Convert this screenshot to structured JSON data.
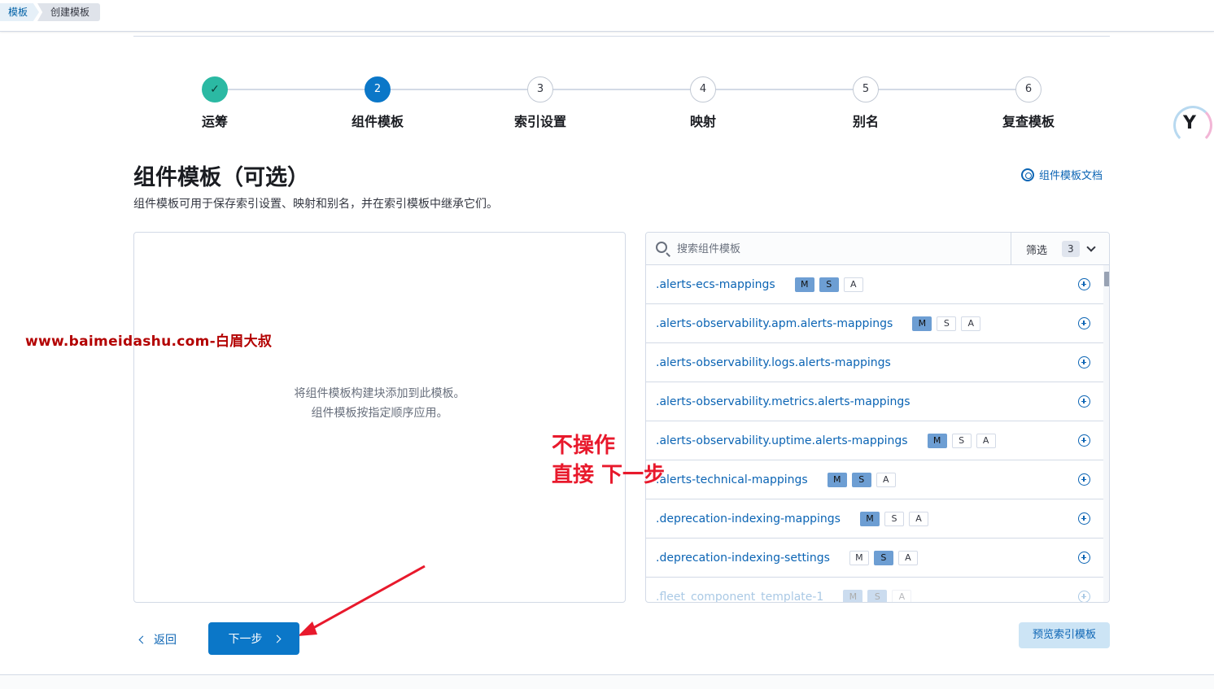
{
  "breadcrumbs": [
    "模板",
    "创建模板"
  ],
  "steps": [
    {
      "num": "✓",
      "label": "运筹",
      "state": "done"
    },
    {
      "num": "2",
      "label": "组件模板",
      "state": "active"
    },
    {
      "num": "3",
      "label": "索引设置",
      "state": "todo"
    },
    {
      "num": "4",
      "label": "映射",
      "state": "todo"
    },
    {
      "num": "5",
      "label": "别名",
      "state": "todo"
    },
    {
      "num": "6",
      "label": "复查模板",
      "state": "todo"
    }
  ],
  "page": {
    "title": "组件模板（可选）",
    "subtitle": "组件模板可用于保存索引设置、映射和别名，并在索引模板中继承它们。",
    "doc_link": "组件模板文档",
    "doc_icon": "help-circle-icon"
  },
  "left_panel": {
    "empty_line1": "将组件模板构建块添加到此模板。",
    "empty_line2": "组件模板按指定顺序应用。"
  },
  "search": {
    "placeholder": "搜索组件模板",
    "filter_label": "筛选",
    "filter_count": "3"
  },
  "components": [
    {
      "name": ".alerts-ecs-mappings",
      "M": true,
      "S": true,
      "A": false
    },
    {
      "name": ".alerts-observability.apm.alerts-mappings",
      "M": true,
      "S": false,
      "A": false
    },
    {
      "name": ".alerts-observability.logs.alerts-mappings",
      "badges": false
    },
    {
      "name": ".alerts-observability.metrics.alerts-mappings",
      "badges": false
    },
    {
      "name": ".alerts-observability.uptime.alerts-mappings",
      "M": true,
      "S": false,
      "A": false
    },
    {
      "name": ".alerts-technical-mappings",
      "M": true,
      "S": true,
      "A": false
    },
    {
      "name": ".deprecation-indexing-mappings",
      "M": true,
      "S": false,
      "A": false
    },
    {
      "name": ".deprecation-indexing-settings",
      "M": false,
      "S": true,
      "A": false
    },
    {
      "name": ".fleet_component_template-1",
      "M": true,
      "S": true,
      "A": false,
      "faded": true
    }
  ],
  "watermark": "www.baimeidashu.com-白眉大叔",
  "annotation": {
    "line1": "不操作",
    "line2": "直接 下一步"
  },
  "buttons": {
    "back": "返回",
    "next": "下一步",
    "preview": "预览索引模板"
  },
  "colors": {
    "primary": "#0b77c8",
    "done": "#2bb9a3",
    "annotation": "#e8192c",
    "watermark": "#b30000"
  }
}
